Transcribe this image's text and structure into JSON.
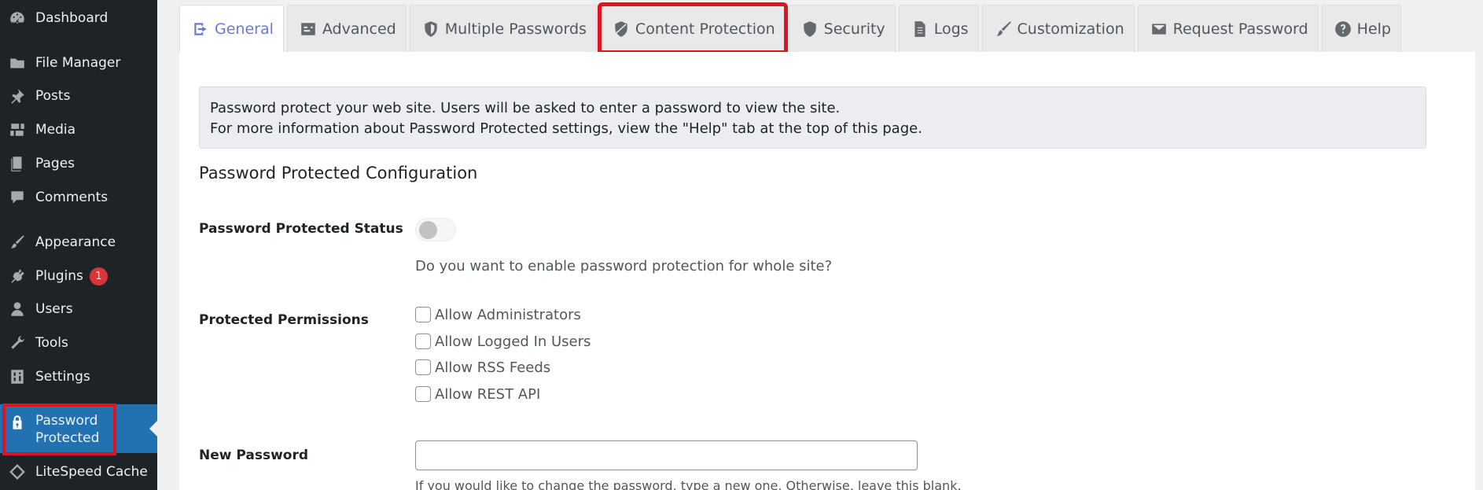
{
  "sidebar": {
    "items": [
      {
        "label": "Dashboard",
        "icon": "dashboard-icon"
      },
      {
        "label": "File Manager",
        "icon": "folder-icon"
      },
      {
        "label": "Posts",
        "icon": "pushpin-icon"
      },
      {
        "label": "Media",
        "icon": "media-icon"
      },
      {
        "label": "Pages",
        "icon": "pages-icon"
      },
      {
        "label": "Comments",
        "icon": "comment-icon"
      },
      {
        "label": "Appearance",
        "icon": "paintbrush-icon"
      },
      {
        "label": "Plugins",
        "icon": "plugin-icon",
        "badge": "1"
      },
      {
        "label": "Users",
        "icon": "user-icon"
      },
      {
        "label": "Tools",
        "icon": "wrench-icon"
      },
      {
        "label": "Settings",
        "icon": "settings-icon"
      },
      {
        "label": "Password\nProtected",
        "icon": "lock-icon"
      },
      {
        "label": "LiteSpeed Cache",
        "icon": "litespeed-icon"
      }
    ]
  },
  "tabs": [
    {
      "label": "General",
      "icon": "general-icon"
    },
    {
      "label": "Advanced",
      "icon": "advanced-icon"
    },
    {
      "label": "Multiple Passwords",
      "icon": "shield-icon"
    },
    {
      "label": "Content Protection",
      "icon": "shield-slash-icon"
    },
    {
      "label": "Security",
      "icon": "shield-icon"
    },
    {
      "label": "Logs",
      "icon": "document-icon"
    },
    {
      "label": "Customization",
      "icon": "brush-icon"
    },
    {
      "label": "Request Password",
      "icon": "envelope-icon"
    },
    {
      "label": "Help",
      "icon": "help-icon"
    }
  ],
  "notice": {
    "line1": "Password protect your web site. Users will be asked to enter a password to view the site.",
    "line2": "For more information about Password Protected settings, view the \"Help\" tab at the top of this page."
  },
  "section_title": "Password Protected Configuration",
  "status": {
    "label": "Password Protected Status",
    "description": "Do you want to enable password protection for whole site?"
  },
  "permissions": {
    "label": "Protected Permissions",
    "options": [
      "Allow Administrators",
      "Allow Logged In Users",
      "Allow RSS Feeds",
      "Allow REST API"
    ]
  },
  "new_password": {
    "label": "New Password",
    "value": "",
    "hint": "If you would like to change the password, type a new one. Otherwise, leave this blank."
  },
  "colors": {
    "sidebar_bg": "#1d2327",
    "active_menu": "#2271b1",
    "active_tab_text": "#6b77e4",
    "highlight": "#e0141e",
    "badge": "#d63638"
  }
}
